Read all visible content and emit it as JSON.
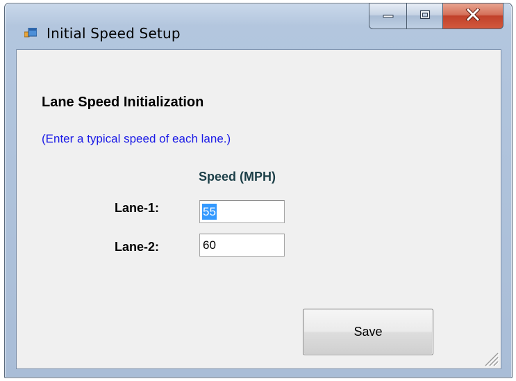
{
  "window": {
    "title": "Initial Speed Setup",
    "icon": "app-window-icon",
    "controls": {
      "minimize_icon": "minimize-icon",
      "maximize_icon": "maximize-icon",
      "close_icon": "close-icon"
    }
  },
  "form": {
    "heading": "Lane Speed Initialization",
    "instruction": "(Enter a typical speed of each lane.)",
    "column_header": "Speed (MPH)",
    "lanes": [
      {
        "label": "Lane-1:",
        "value": "55",
        "selected": true
      },
      {
        "label": "Lane-2:",
        "value": "60",
        "selected": false
      }
    ],
    "save_label": "Save"
  },
  "colors": {
    "instruction_text": "#1a1ae6",
    "column_header_text": "#1c3f48",
    "selection_highlight": "#3399ff",
    "close_button": "#c0412a",
    "client_background": "#f0f0f0"
  }
}
